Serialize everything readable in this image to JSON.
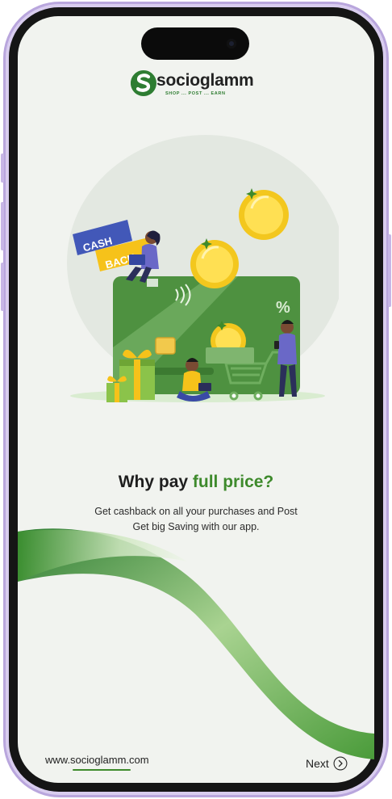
{
  "brand": {
    "name": "socioglamm",
    "tagline": "SHOP ... POST ... EARN",
    "primary_color": "#3e8a2c",
    "accent_color": "#f6c21a"
  },
  "illustration": {
    "badge_top": "CASH",
    "badge_bottom": "BACK",
    "card_symbol": "%"
  },
  "onboarding": {
    "headline_prefix": "Why pay ",
    "headline_accent": "full price?",
    "description_line1": "Get cashback on all your purchases and Post",
    "description_line2": "Get big Saving with our app."
  },
  "footer": {
    "website": "www.socioglamm.com",
    "next_label": "Next",
    "next_icon": "chevron-right-circle-icon"
  }
}
